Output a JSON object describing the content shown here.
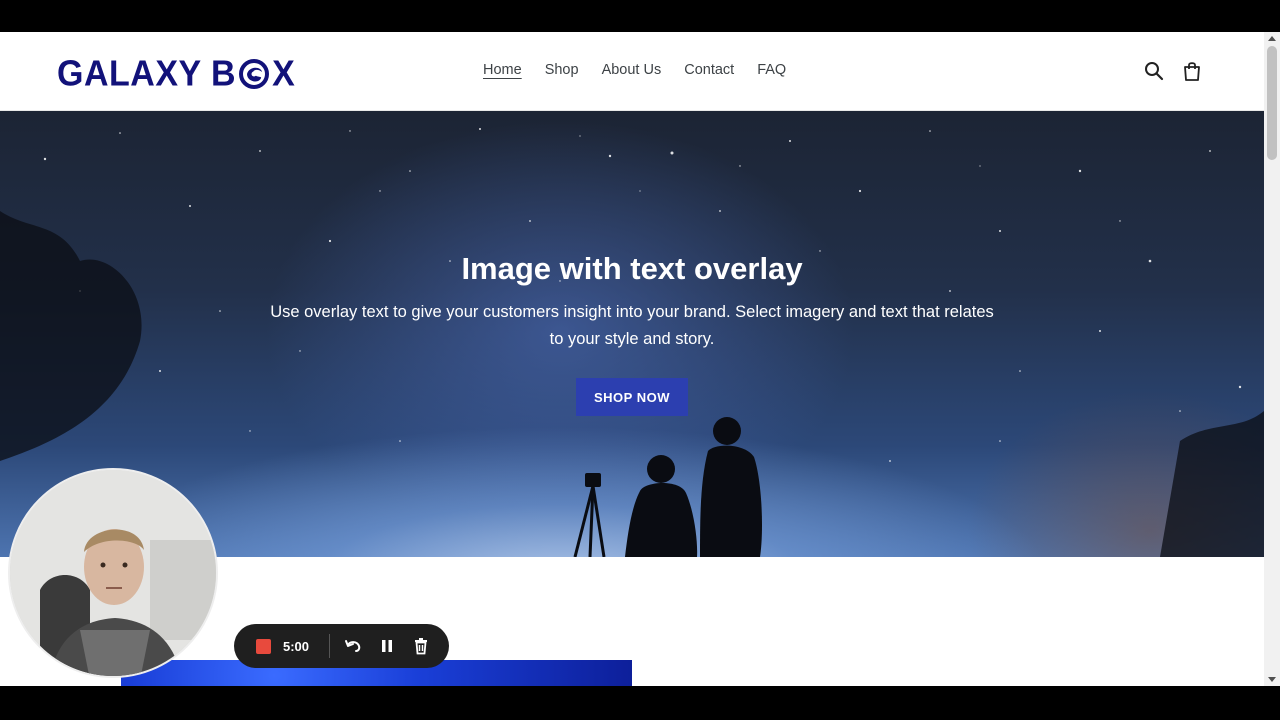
{
  "header": {
    "logo_text_1": "GALAXY B",
    "logo_text_2": "X",
    "nav": [
      {
        "label": "Home"
      },
      {
        "label": "Shop"
      },
      {
        "label": "About Us"
      },
      {
        "label": "Contact"
      },
      {
        "label": "FAQ"
      }
    ]
  },
  "hero": {
    "title": "Image with text overlay",
    "text": "Use overlay text to give your customers insight into your brand. Select imagery and text that relates to your style and story.",
    "button": "SHOP NOW"
  },
  "recorder": {
    "time": "5:00"
  },
  "colors": {
    "brand": "#12127a",
    "button": "#2c3fb0",
    "record": "#e84a3d"
  },
  "icons": [
    "search-icon",
    "cart-icon",
    "record-icon",
    "undo-icon",
    "pause-icon",
    "trash-icon"
  ]
}
